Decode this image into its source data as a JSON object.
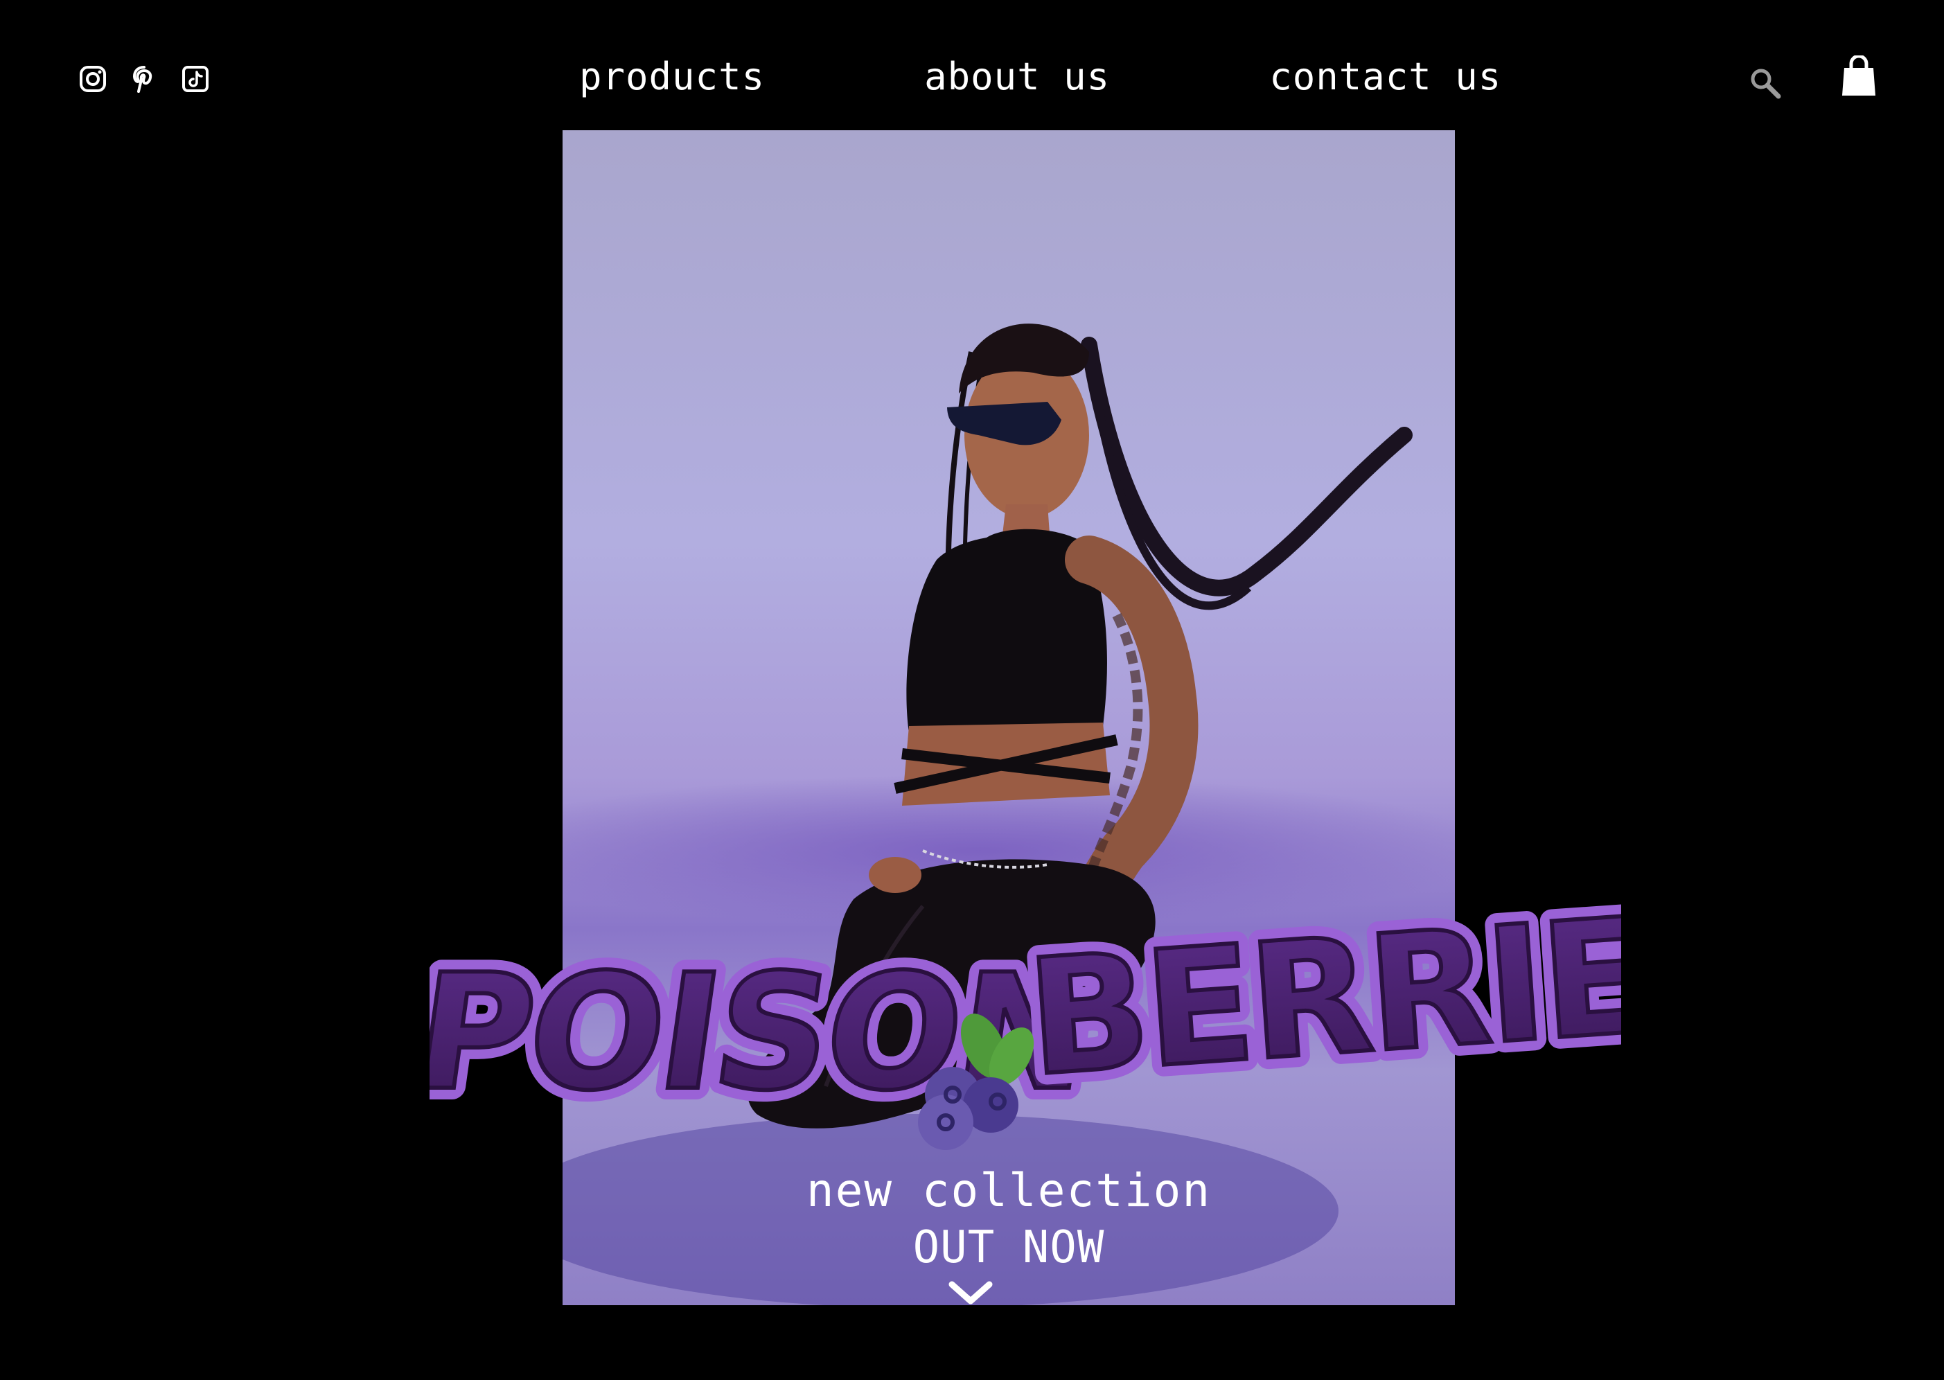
{
  "header": {
    "social_icons": [
      "instagram-icon",
      "pinterest-icon",
      "tiktok-icon"
    ],
    "nav": [
      {
        "label": "products"
      },
      {
        "label": "about us"
      },
      {
        "label": "contact us"
      }
    ],
    "search_icon": "search-icon",
    "cart_icon": "shopping-bag-icon"
  },
  "hero": {
    "logo_text": "POISON BERRIES",
    "headline": "new collection",
    "subheadline": "OUT NOW",
    "scroll_icon": "chevron-down-icon"
  },
  "colors": {
    "background": "#000000",
    "logo_fill": "#4a2470",
    "logo_outline": "#9a62d6",
    "photo_bg": "#aaa6d4",
    "text": "#ffffff"
  }
}
